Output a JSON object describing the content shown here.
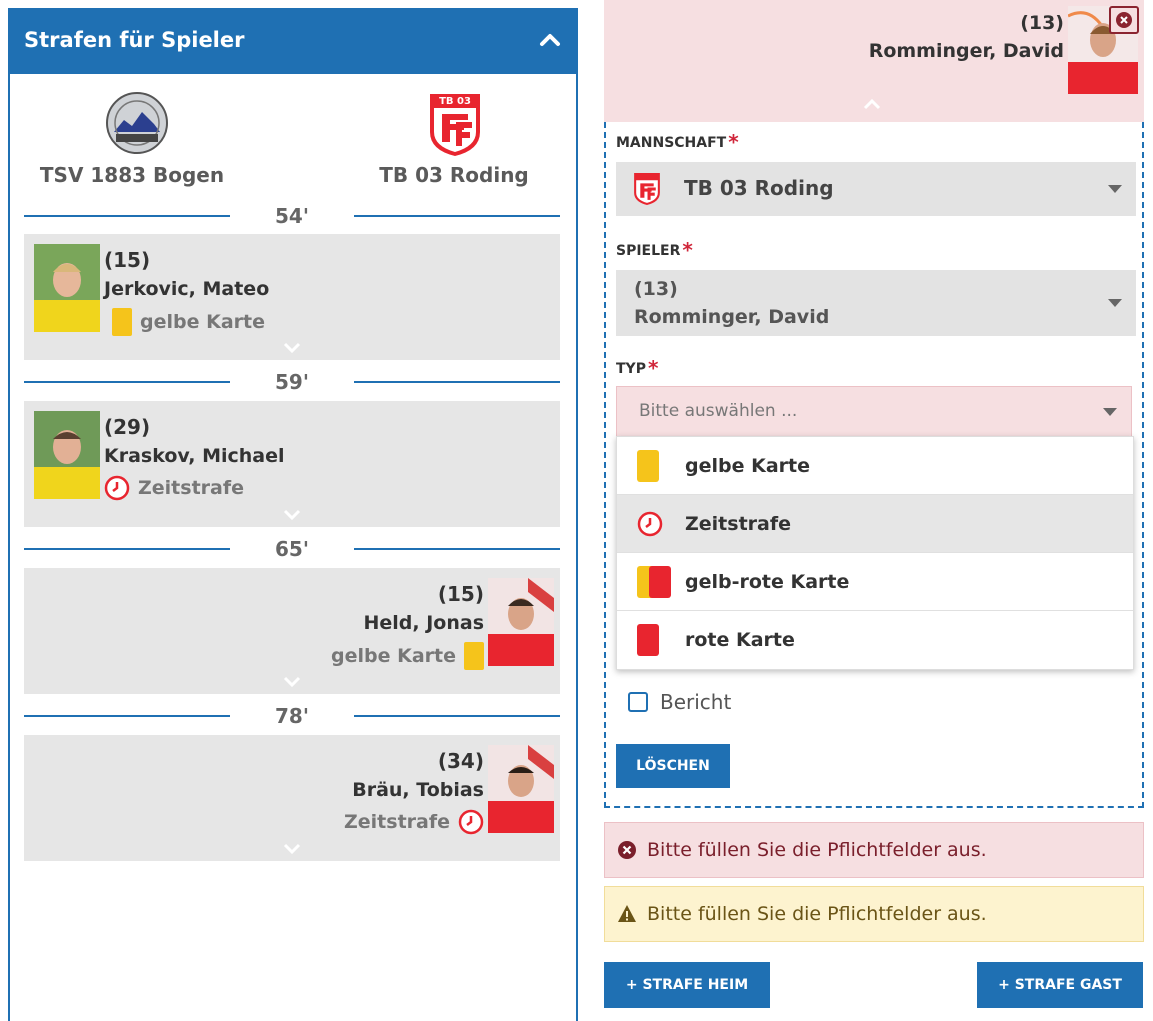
{
  "header": {
    "title": "Strafen für Spieler"
  },
  "teams": {
    "home": {
      "name": "TSV 1883 Bogen"
    },
    "away": {
      "name": "TB 03 Roding",
      "logo_text": "TB 03"
    }
  },
  "events": [
    {
      "minute": "54'",
      "side": "home",
      "number": "(15)",
      "name": "Jerkovic, Mateo",
      "type": "gelbe Karte",
      "icon": "yellow-card-icon"
    },
    {
      "minute": "59'",
      "side": "home",
      "number": "(29)",
      "name": "Kraskov, Michael",
      "type": "Zeitstrafe",
      "icon": "clock-icon"
    },
    {
      "minute": "65'",
      "side": "away",
      "number": "(15)",
      "name": "Held, Jonas",
      "type": "gelbe Karte",
      "icon": "yellow-card-icon"
    },
    {
      "minute": "78'",
      "side": "away",
      "number": "(34)",
      "name": "Bräu, Tobias",
      "type": "Zeitstrafe",
      "icon": "clock-icon"
    }
  ],
  "edit": {
    "selected_player": {
      "number": "(13)",
      "name": "Romminger, David"
    },
    "fields": {
      "team": {
        "label": "MANNSCHAFT",
        "value": "TB 03 Roding"
      },
      "player": {
        "label": "SPIELER",
        "value_number": "(13)",
        "value_name": "Romminger, David"
      },
      "type": {
        "label": "TYP",
        "placeholder": "Bitte auswählen ..."
      }
    },
    "type_options": [
      {
        "label": "gelbe Karte",
        "icon": "yellow-card-icon"
      },
      {
        "label": "Zeitstrafe",
        "icon": "clock-icon",
        "highlighted": true
      },
      {
        "label": "gelb-rote Karte",
        "icon": "yellow-red-card-icon"
      },
      {
        "label": "rote Karte",
        "icon": "red-card-icon"
      }
    ],
    "report_label": "Bericht",
    "delete_label": "LÖSCHEN"
  },
  "alerts": {
    "error": "Bitte füllen Sie die Pflichtfelder aus.",
    "warning": "Bitte füllen Sie die Pflichtfelder aus."
  },
  "buttons": {
    "add_home": "+ STRAFE HEIM",
    "add_away": "+ STRAFE GAST"
  },
  "colors": {
    "primary": "#1f70b3",
    "yellow_card": "#f5c41b",
    "red_card": "#e8252f",
    "error_bg": "#f6dfe1",
    "warning_bg": "#fdf3cf"
  }
}
